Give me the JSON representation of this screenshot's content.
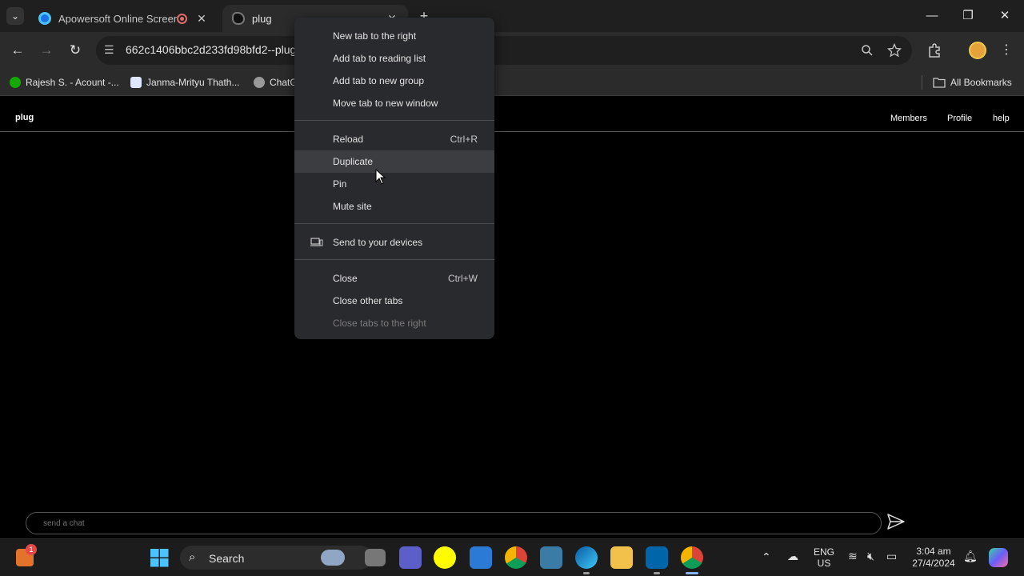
{
  "tabs": [
    {
      "title": "Apowersoft Online Screen R",
      "close": "✕"
    },
    {
      "title": "plug",
      "close": "✕"
    }
  ],
  "tabstrip": {
    "new_tab": "+",
    "menu": "⌄"
  },
  "window": {
    "minimize": "—",
    "restore": "❐",
    "close": "✕"
  },
  "toolbar": {
    "back": "←",
    "forward": "→",
    "reload": "↻",
    "url": "662c1406bbc2d233fd98bfd2--plug"
  },
  "bookmarks": [
    {
      "label": "Rajesh S. - Acount -..."
    },
    {
      "label": "Janma-Mrityu Thath..."
    },
    {
      "label": "ChatG"
    }
  ],
  "all_bookmarks": "All Bookmarks",
  "page": {
    "brand": "plug",
    "nav": [
      "Members",
      "Profile",
      "help"
    ]
  },
  "chat": {
    "placeholder": "send a chat"
  },
  "context_menu": {
    "items": [
      {
        "label": "New tab to the right",
        "shortcut": ""
      },
      {
        "label": "Add tab to reading list",
        "shortcut": ""
      },
      {
        "label": "Add tab to new group",
        "shortcut": ""
      },
      {
        "label": "Move tab to new window",
        "shortcut": ""
      },
      {
        "label": "Reload",
        "shortcut": "Ctrl+R"
      },
      {
        "label": "Duplicate",
        "shortcut": ""
      },
      {
        "label": "Pin",
        "shortcut": ""
      },
      {
        "label": "Mute site",
        "shortcut": ""
      },
      {
        "label": "Send to your devices",
        "shortcut": ""
      },
      {
        "label": "Close",
        "shortcut": "Ctrl+W"
      },
      {
        "label": "Close other tabs",
        "shortcut": ""
      },
      {
        "label": "Close tabs to the right",
        "shortcut": ""
      }
    ]
  },
  "taskbar": {
    "search": "Search",
    "notification_badge": "1",
    "lang_top": "ENG",
    "lang_bottom": "US",
    "time": "3:04 am",
    "date": "27/4/2024"
  },
  "colors": {
    "chrome_dark": "#1f1f1f",
    "toolbar": "#2b2b2b",
    "menu_bg": "#292a2d",
    "menu_hover": "#3c3d40",
    "page_bg": "#000000"
  }
}
